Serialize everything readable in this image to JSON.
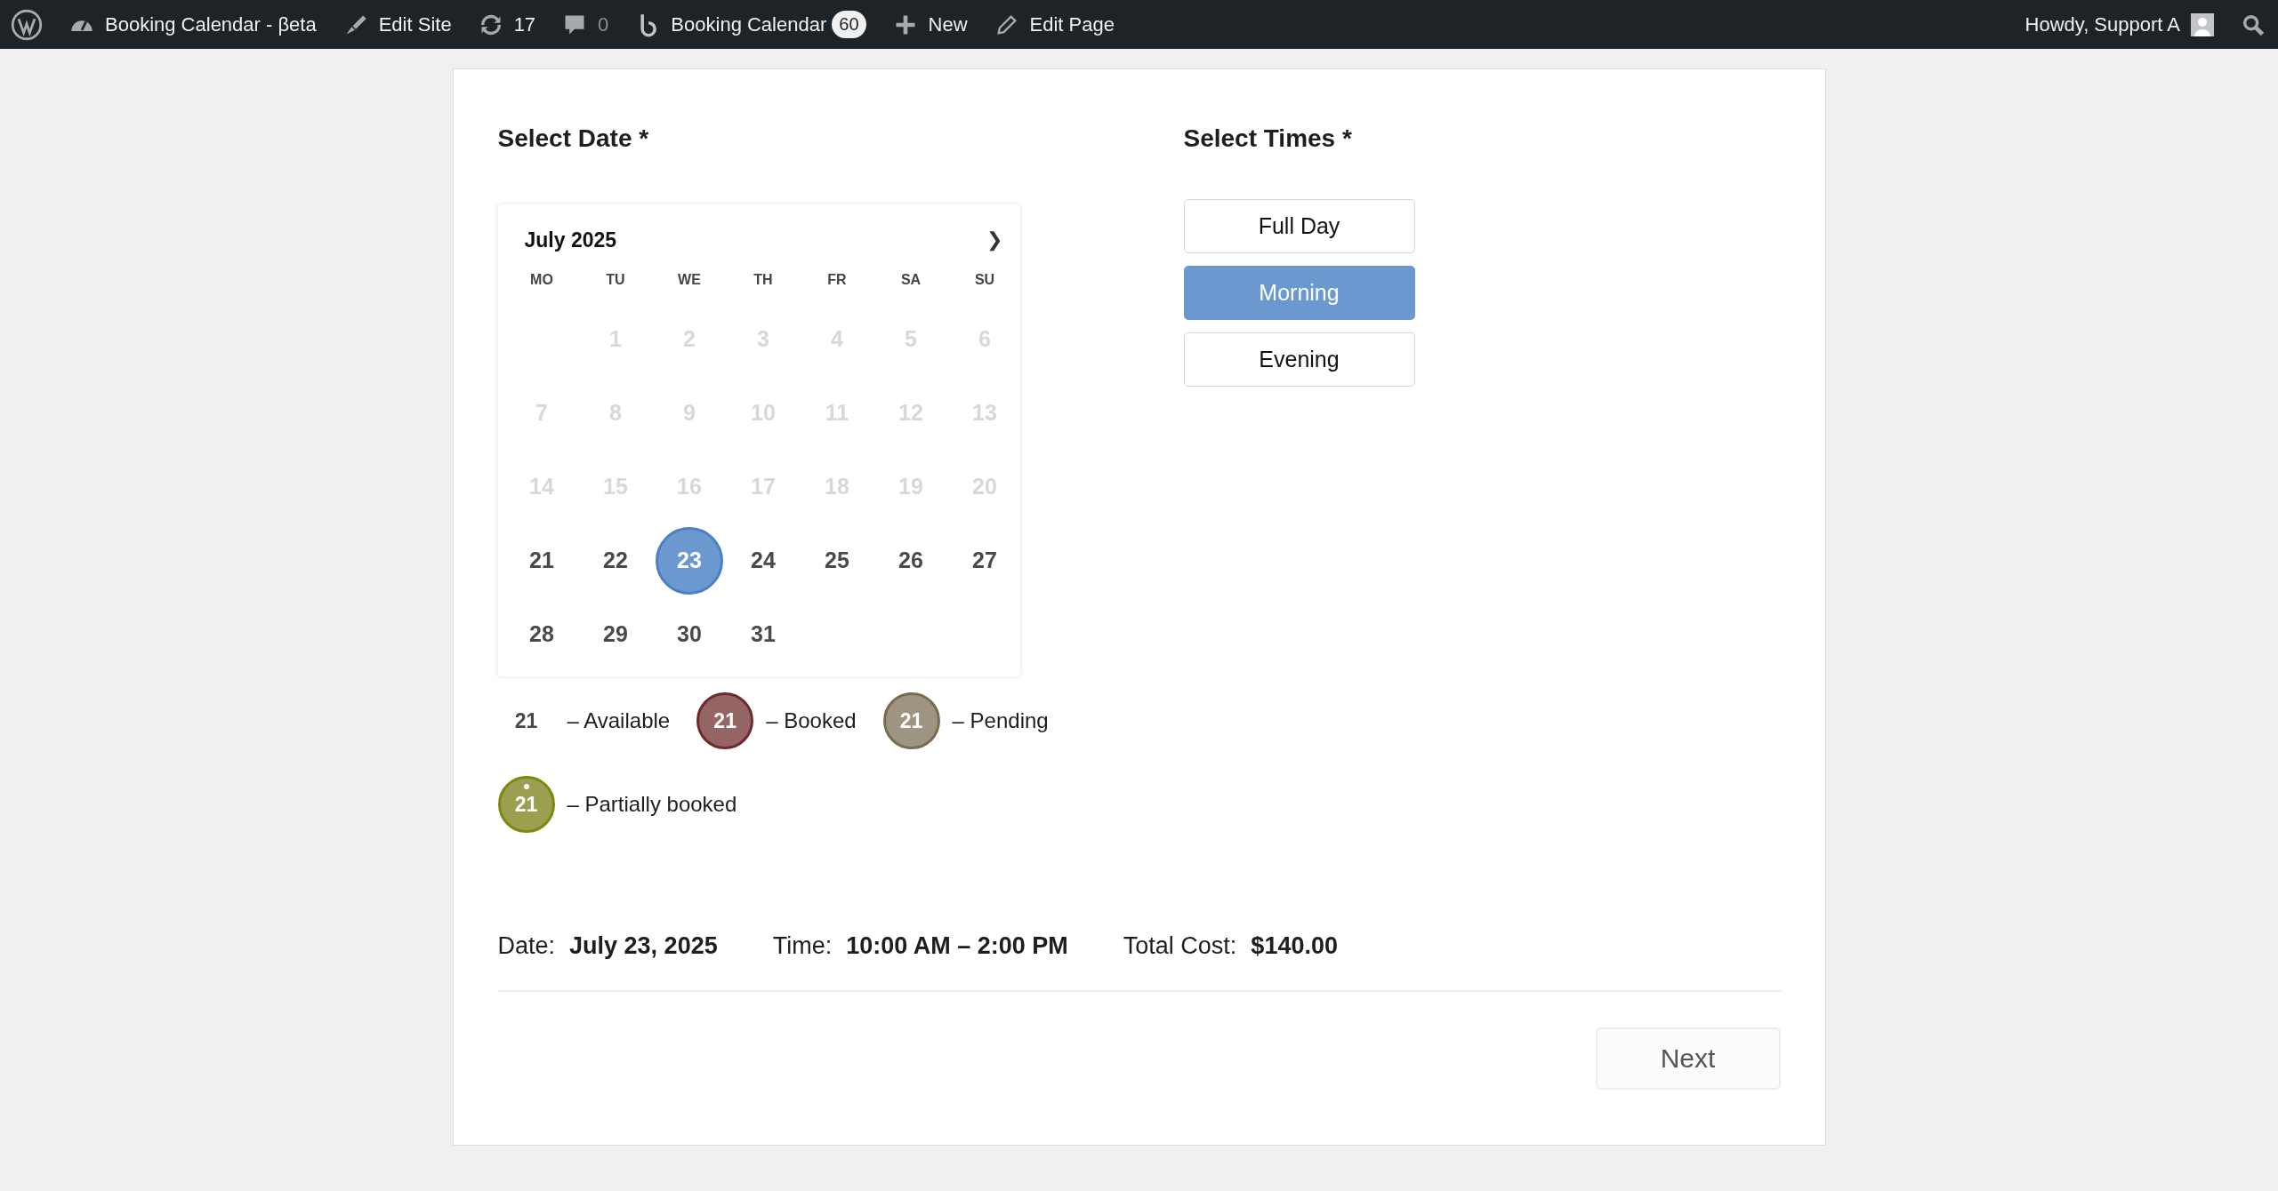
{
  "admin_bar": {
    "items": [
      {
        "kind": "wp"
      },
      {
        "kind": "dashboard",
        "label": "Booking Calendar - βeta"
      },
      {
        "kind": "brush",
        "label": "Edit Site"
      },
      {
        "kind": "updates",
        "label": "17"
      },
      {
        "kind": "comments",
        "label": "0"
      },
      {
        "kind": "booking",
        "label": "Booking Calendar",
        "badge": "60"
      },
      {
        "kind": "plus",
        "label": "New"
      },
      {
        "kind": "pencil",
        "label": "Edit Page"
      }
    ],
    "greeting": "Howdy, Support A"
  },
  "date_section": {
    "title": "Select Date *",
    "calendar": {
      "month": "July 2025",
      "next": "❯",
      "weekdays": [
        "MO",
        "TU",
        "WE",
        "TH",
        "FR",
        "SA",
        "SU"
      ],
      "weeks": [
        [
          {
            "day": "1",
            "disabled": true,
            "selected": false
          },
          {
            "day": "2",
            "disabled": true,
            "selected": false
          },
          {
            "day": "3",
            "disabled": true,
            "selected": false
          },
          {
            "day": "4",
            "disabled": true,
            "selected": false
          },
          {
            "day": "5",
            "disabled": true,
            "selected": false
          },
          {
            "day": "6",
            "disabled": true,
            "selected": false
          }
        ],
        [
          {
            "day": "7",
            "disabled": true,
            "selected": false
          },
          {
            "day": "8",
            "disabled": true,
            "selected": false
          },
          {
            "day": "9",
            "disabled": true,
            "selected": false
          },
          {
            "day": "10",
            "disabled": true,
            "selected": false
          },
          {
            "day": "11",
            "disabled": true,
            "selected": false
          },
          {
            "day": "12",
            "disabled": true,
            "selected": false
          },
          {
            "day": "13",
            "disabled": true,
            "selected": false
          }
        ],
        [
          {
            "day": "14",
            "disabled": true,
            "selected": false
          },
          {
            "day": "15",
            "disabled": true,
            "selected": false
          },
          {
            "day": "16",
            "disabled": true,
            "selected": false
          },
          {
            "day": "17",
            "disabled": true,
            "selected": false
          },
          {
            "day": "18",
            "disabled": true,
            "selected": false
          },
          {
            "day": "19",
            "disabled": true,
            "selected": false
          },
          {
            "day": "20",
            "disabled": true,
            "selected": false
          }
        ],
        [
          {
            "day": "21",
            "disabled": false,
            "selected": false
          },
          {
            "day": "22",
            "disabled": false,
            "selected": false
          },
          {
            "day": "23",
            "disabled": false,
            "selected": true
          },
          {
            "day": "24",
            "disabled": false,
            "selected": false
          },
          {
            "day": "25",
            "disabled": false,
            "selected": false
          },
          {
            "day": "26",
            "disabled": false,
            "selected": false
          },
          {
            "day": "27",
            "disabled": false,
            "selected": false
          }
        ],
        [
          {
            "day": "28",
            "disabled": false,
            "selected": false
          },
          {
            "day": "29",
            "disabled": false,
            "selected": false
          },
          {
            "day": "30",
            "disabled": false,
            "selected": false
          },
          {
            "day": "31",
            "disabled": false,
            "selected": false
          }
        ]
      ]
    },
    "legend": [
      {
        "kind": "available",
        "sample": "21",
        "label": "– Available"
      },
      {
        "kind": "booked",
        "sample": "21",
        "label": "– Booked",
        "color": "#956566"
      },
      {
        "kind": "pending",
        "sample": "21",
        "label": "– Pending",
        "color": "#9d9482"
      },
      {
        "kind": "partial",
        "sample": "21",
        "label": "– Partially booked",
        "color": "#9aa04f"
      }
    ]
  },
  "times_section": {
    "title": "Select Times *",
    "options": [
      {
        "label": "Full Day",
        "selected": false
      },
      {
        "label": "Morning",
        "selected": true
      },
      {
        "label": "Evening",
        "selected": false
      }
    ]
  },
  "summary": [
    {
      "label": "Date:",
      "value": "July 23, 2025"
    },
    {
      "label": "Time:",
      "value": "10:00 AM – 2:00 PM"
    },
    {
      "label": "Total Cost:",
      "value": "$140.00"
    }
  ],
  "next_button": "Next"
}
